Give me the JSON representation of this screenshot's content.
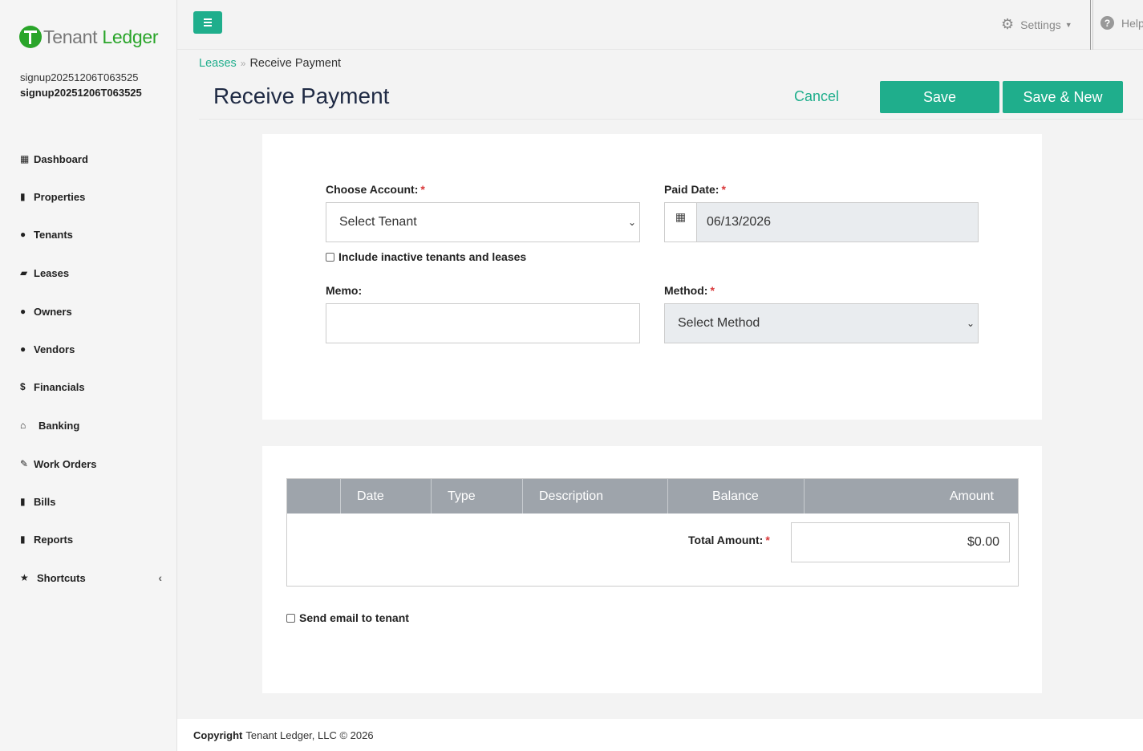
{
  "brand": {
    "name_part1": "Tenant",
    "name_part2": "Ledger",
    "accent": "#1fae8c",
    "logo_green": "#2aa52a"
  },
  "user": {
    "line1": "signup20251206T063525",
    "line2": "signup20251206T063525"
  },
  "sidebar": {
    "items": [
      {
        "label": "Dashboard",
        "icon": "dashboard-icon"
      },
      {
        "label": "Properties",
        "icon": "building-icon"
      },
      {
        "label": "Tenants",
        "icon": "user-icon"
      },
      {
        "label": "Leases",
        "icon": "folder-open-icon"
      },
      {
        "label": "Owners",
        "icon": "users-icon"
      },
      {
        "label": "Vendors",
        "icon": "users-icon"
      },
      {
        "label": "Financials",
        "icon": "dollar-icon"
      },
      {
        "label": "Banking",
        "icon": "bank-icon"
      },
      {
        "label": "Work Orders",
        "icon": "edit-icon"
      },
      {
        "label": "Bills",
        "icon": "file-icon"
      },
      {
        "label": "Reports",
        "icon": "file-icon"
      },
      {
        "label": "Shortcuts",
        "icon": "star-icon"
      }
    ]
  },
  "topbar": {
    "settings_label": "Settings",
    "help_label": "Help"
  },
  "breadcrumb": {
    "parent": "Leases",
    "current": "Receive Payment"
  },
  "header": {
    "title": "Receive Payment",
    "cancel_label": "Cancel",
    "save_label": "Save",
    "save_new_label": "Save & New"
  },
  "form": {
    "account_label": "Choose Account:",
    "account_value": "Select Tenant",
    "include_inactive_label": "Include inactive tenants and leases",
    "paid_date_label": "Paid Date:",
    "paid_date_value": "06/13/2026",
    "memo_label": "Memo:",
    "memo_value": "",
    "method_label": "Method:",
    "method_value": "Select Method",
    "required_mark": "*"
  },
  "table": {
    "columns": [
      "",
      "Date",
      "Type",
      "Description",
      "Balance",
      "Amount"
    ],
    "total_label": "Total Amount:",
    "total_value": "$0.00"
  },
  "send_email_label": "Send email to tenant",
  "footer": {
    "copyright_label": "Copyright",
    "copyright_text": "Tenant Ledger, LLC © 2026"
  }
}
